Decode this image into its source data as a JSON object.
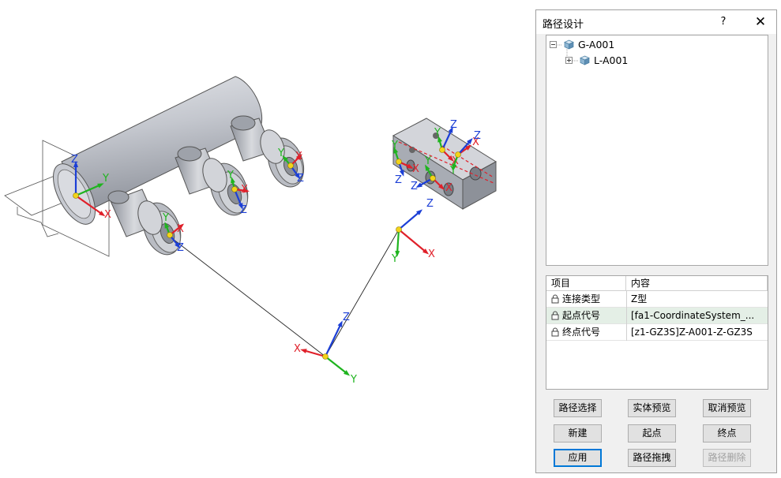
{
  "dialog": {
    "title": "路径设计",
    "help_label": "?",
    "close_label": "✕"
  },
  "tree": {
    "root": {
      "label": "G-A001",
      "expanded": true
    },
    "child": {
      "label": "L-A001",
      "expanded": false
    }
  },
  "grid": {
    "columns": [
      "项目",
      "内容"
    ],
    "rows": [
      {
        "name": "连接类型",
        "value": "Z型",
        "selected": false
      },
      {
        "name": "起点代号",
        "value": "[fa1-CoordinateSystem_...",
        "selected": true
      },
      {
        "name": "终点代号",
        "value": "[z1-GZ3S]Z-A001-Z-GZ3S",
        "selected": false
      }
    ]
  },
  "buttons": {
    "path_select": "路径选择",
    "solid_preview": "实体预览",
    "cancel_preview": "取消预览",
    "new": "新建",
    "start_point": "起点",
    "end_point": "终点",
    "apply": "应用",
    "path_drag": "路径拖拽",
    "path_delete": "路径删除"
  },
  "axes": {
    "x": "X",
    "y": "Y",
    "z": "Z"
  },
  "colors": {
    "x_axis": "#e0202a",
    "y_axis": "#1fb41f",
    "z_axis": "#1c3fd6",
    "point": "#f2d31a",
    "model_gray": "#bfc2c9"
  }
}
